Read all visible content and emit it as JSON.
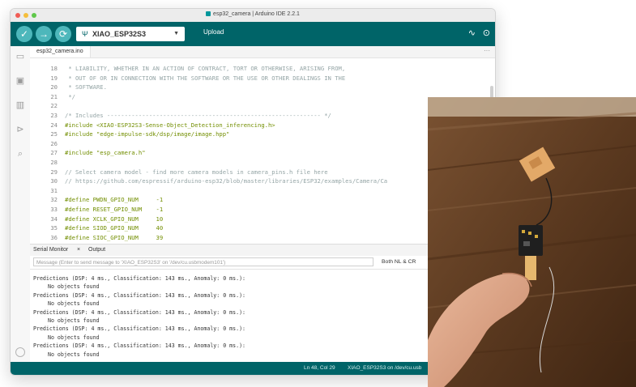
{
  "window": {
    "title": "esp32_camera | Arduino IDE 2.2.1"
  },
  "toolbar": {
    "board": "XIAO_ESP32S3",
    "upload_label": "Upload",
    "icons": {
      "verify": "check-icon",
      "upload": "arrow-right-icon",
      "debug": "debug-icon",
      "plotter": "serial-plotter-icon",
      "monitor": "serial-monitor-icon"
    }
  },
  "editor": {
    "file_tab": "esp32_camera.ino",
    "lines": [
      {
        "n": "18",
        "t": " * LIABILITY, WHETHER IN AN ACTION OF CONTRACT, TORT OR OTHERWISE, ARISING FROM,",
        "k": "cm"
      },
      {
        "n": "19",
        "t": " * OUT OF OR IN CONNECTION WITH THE SOFTWARE OR THE USE OR OTHER DEALINGS IN THE",
        "k": "cm"
      },
      {
        "n": "20",
        "t": " * SOFTWARE.",
        "k": "cm"
      },
      {
        "n": "21",
        "t": " */",
        "k": "cm"
      },
      {
        "n": "22",
        "t": "",
        "k": "tx"
      },
      {
        "n": "23",
        "t": "/* Includes ------------------------------------------------------------- */",
        "k": "cm"
      },
      {
        "n": "24",
        "t": "#include <XIAO-ESP32S3-Sense-Object_Detection_inferencing.h>",
        "k": "pp"
      },
      {
        "n": "25",
        "t": "#include \"edge-impulse-sdk/dsp/image/image.hpp\"",
        "k": "pp"
      },
      {
        "n": "26",
        "t": "",
        "k": "tx"
      },
      {
        "n": "27",
        "t": "#include \"esp_camera.h\"",
        "k": "pp"
      },
      {
        "n": "28",
        "t": "",
        "k": "tx"
      },
      {
        "n": "29",
        "t": "// Select camera model - find more camera models in camera_pins.h file here",
        "k": "cm"
      },
      {
        "n": "30",
        "t": "// https://github.com/espressif/arduino-esp32/blob/master/libraries/ESP32/examples/Camera/Ca",
        "k": "cm"
      },
      {
        "n": "31",
        "t": "",
        "k": "tx"
      },
      {
        "n": "32",
        "t": "#define PWDN_GPIO_NUM     -1",
        "k": "pp"
      },
      {
        "n": "33",
        "t": "#define RESET_GPIO_NUM    -1",
        "k": "pp"
      },
      {
        "n": "34",
        "t": "#define XCLK_GPIO_NUM     10",
        "k": "pp"
      },
      {
        "n": "35",
        "t": "#define SIOD_GPIO_NUM     40",
        "k": "pp"
      },
      {
        "n": "36",
        "t": "#define SIOC_GPIO_NUM     39",
        "k": "pp"
      }
    ]
  },
  "bottom_panel": {
    "serial_tab": "Serial Monitor",
    "close_glyph": "×",
    "output_tab": "Output",
    "message_placeholder": "Message (Enter to send message to 'XIAO_ESP32S3' on '/dev/cu.usbmodem101')",
    "line_ending": "Both NL & CR",
    "serial_lines": [
      {
        "t": "Predictions (DSP: 4 ms., Classification: 143 ms., Anomaly: 0 ms.):",
        "ind": false
      },
      {
        "t": "No objects found",
        "ind": true
      },
      {
        "t": "Predictions (DSP: 4 ms., Classification: 143 ms., Anomaly: 0 ms.):",
        "ind": false
      },
      {
        "t": "No objects found",
        "ind": true
      },
      {
        "t": "Predictions (DSP: 4 ms., Classification: 143 ms., Anomaly: 0 ms.):",
        "ind": false
      },
      {
        "t": "No objects found",
        "ind": true
      },
      {
        "t": "Predictions (DSP: 4 ms., Classification: 143 ms., Anomaly: 0 ms.):",
        "ind": false
      },
      {
        "t": "No objects found",
        "ind": true
      },
      {
        "t": "Predictions (DSP: 4 ms., Classification: 143 ms., Anomaly: 0 ms.):",
        "ind": false
      },
      {
        "t": "No objects found",
        "ind": true
      }
    ]
  },
  "status_bar": {
    "position": "Ln 48, Col 29",
    "board_port": "XIAO_ESP32S3 on /dev/cu.usb"
  },
  "sidebar_icons": [
    "folder-icon",
    "boards-manager-icon",
    "library-icon",
    "debug-icon",
    "search-icon",
    "account-icon"
  ]
}
